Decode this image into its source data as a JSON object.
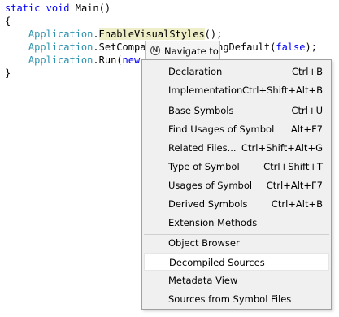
{
  "code": {
    "line1": {
      "kw1": "static",
      "kw2": "void",
      "rest": " Main()"
    },
    "line2": "{",
    "line3": {
      "cls": "Application",
      "dot": ".",
      "method": "EnableVisualStyles",
      "rest": "();"
    },
    "line4": {
      "cls": "Application",
      "dot": ".",
      "partial": "SetCompa",
      "tail": "eringDefault(",
      "kw": "false",
      "end": ");"
    },
    "line5": {
      "cls": "Application",
      "dot": ".",
      "partial": "Run(",
      "kw": "new"
    },
    "line6": "}"
  },
  "popup": {
    "icon": "navigate-icon",
    "title": "Navigate to"
  },
  "menu": {
    "items": [
      {
        "label": "Declaration",
        "shortcut": "Ctrl+B"
      },
      {
        "label": "Implementation",
        "shortcut": "Ctrl+Shift+Alt+B"
      },
      {
        "label": "Base Symbols",
        "shortcut": "Ctrl+U"
      },
      {
        "label": "Find Usages of Symbol",
        "shortcut": "Alt+F7"
      },
      {
        "label": "Related Files...",
        "shortcut": "Ctrl+Shift+Alt+G"
      },
      {
        "label": "Type of Symbol",
        "shortcut": "Ctrl+Shift+T"
      },
      {
        "label": "Usages of Symbol",
        "shortcut": "Ctrl+Alt+F7"
      },
      {
        "label": "Derived Symbols",
        "shortcut": "Ctrl+Alt+B"
      },
      {
        "label": "Extension Methods",
        "shortcut": ""
      },
      {
        "label": "Object Browser",
        "shortcut": ""
      },
      {
        "label": "Decompiled Sources",
        "shortcut": "",
        "selected": true
      },
      {
        "label": "Metadata View",
        "shortcut": ""
      },
      {
        "label": "Sources from Symbol Files",
        "shortcut": ""
      }
    ]
  },
  "colors": {
    "keyword": "#0000ff",
    "class": "#2b91af",
    "highlight": "#eeeec8",
    "menu_bg": "#f0f0f0"
  }
}
